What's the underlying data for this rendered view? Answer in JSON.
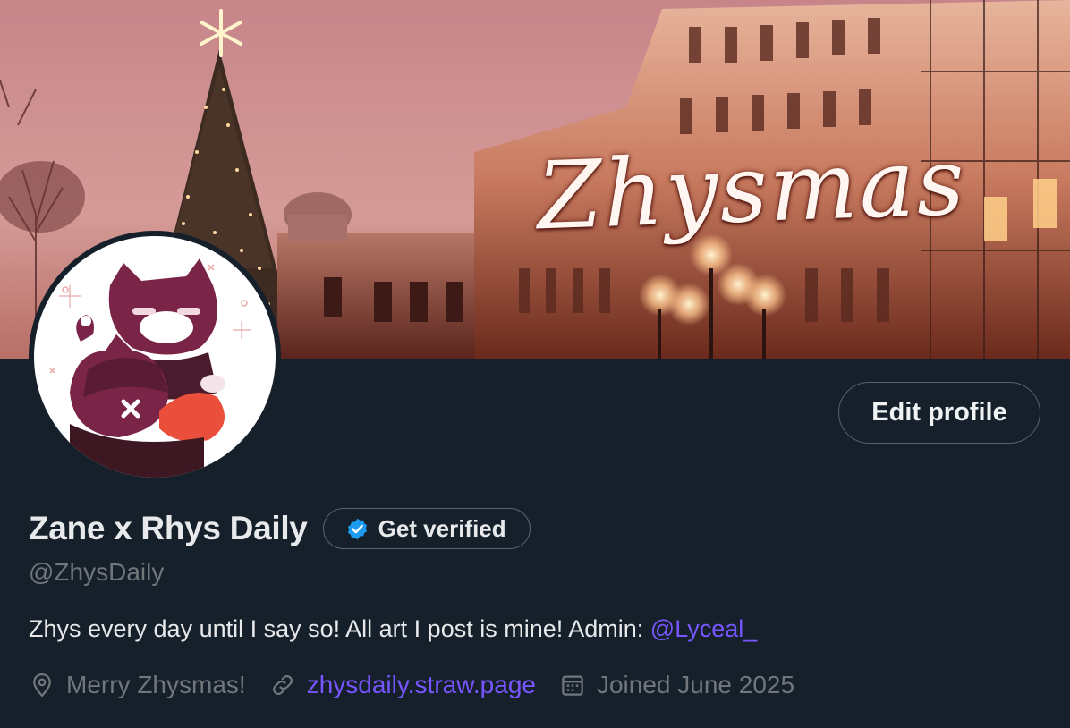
{
  "banner": {
    "title": "Zhysmas"
  },
  "profile": {
    "edit_label": "Edit profile",
    "display_name": "Zane x Rhys Daily",
    "verify_label": "Get verified",
    "handle": "@ZhysDaily",
    "bio_text": "Zhys every day until I say so! All art I post is mine! Admin: ",
    "bio_mention": "@Lyceal_",
    "location": "Merry Zhysmas!",
    "website": "zhysdaily.straw.page",
    "joined": "Joined June 2025"
  },
  "icons": {
    "location": "map-pin-icon",
    "website": "link-icon",
    "joined": "calendar-icon",
    "verified": "verified-badge-icon"
  },
  "colors": {
    "background": "#15202b",
    "text_primary": "#e7e9ea",
    "text_secondary": "#71767b",
    "accent": "#7856ff",
    "verified_blue": "#1d9bf0"
  }
}
